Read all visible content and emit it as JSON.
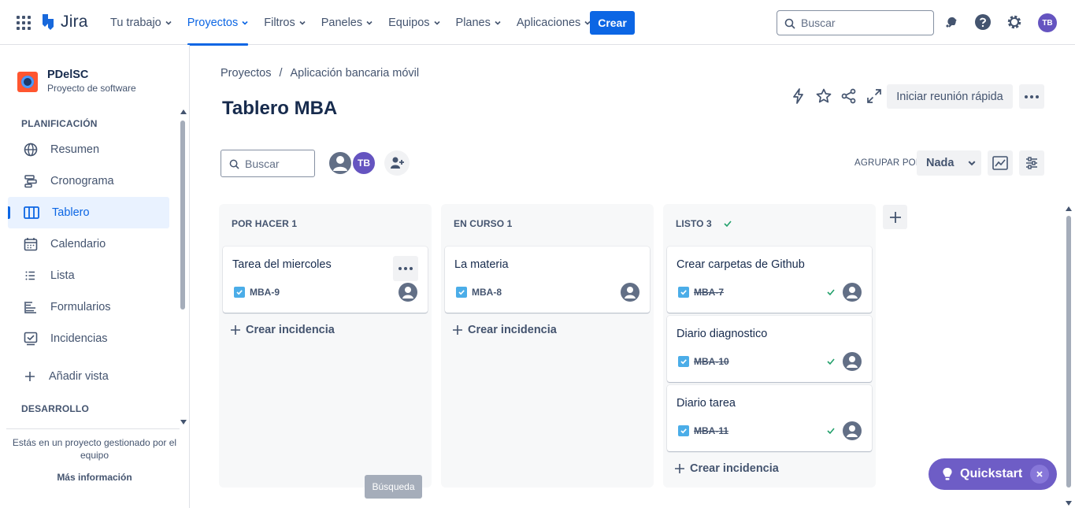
{
  "topnav": {
    "logo_text": "Jira",
    "items": [
      {
        "label": "Tu trabajo",
        "active": false
      },
      {
        "label": "Proyectos",
        "active": true
      },
      {
        "label": "Filtros",
        "active": false
      },
      {
        "label": "Paneles",
        "active": false
      },
      {
        "label": "Equipos",
        "active": false
      },
      {
        "label": "Planes",
        "active": false
      },
      {
        "label": "Aplicaciones",
        "active": false
      }
    ],
    "create_label": "Crear",
    "search_placeholder": "Buscar",
    "avatar_initials": "TB"
  },
  "sidebar": {
    "project_name": "PDelSC",
    "project_type": "Proyecto de software",
    "planning_title": "PLANIFICACIÓN",
    "items": [
      {
        "label": "Resumen",
        "icon": "globe-icon"
      },
      {
        "label": "Cronograma",
        "icon": "timeline-icon"
      },
      {
        "label": "Tablero",
        "icon": "board-icon",
        "active": true
      },
      {
        "label": "Calendario",
        "icon": "calendar-icon"
      },
      {
        "label": "Lista",
        "icon": "list-icon"
      },
      {
        "label": "Formularios",
        "icon": "forms-icon"
      },
      {
        "label": "Incidencias",
        "icon": "issues-icon"
      }
    ],
    "add_view_label": "Añadir vista",
    "development_title": "DESARROLLO",
    "footer_text": "Estás en un proyecto gestionado por el equipo",
    "footer_link": "Más información"
  },
  "main": {
    "breadcrumb": [
      "Proyectos",
      "/",
      "Aplicación bancaria móvil"
    ],
    "title": "Tablero MBA",
    "meet_label": "Iniciar reunión rápida",
    "search_placeholder": "Buscar",
    "user_initials": "TB",
    "group_label": "AGRUPAR POR",
    "group_value": "Nada"
  },
  "columns": [
    {
      "title": "POR HACER 1",
      "done": false,
      "cards": [
        {
          "title": "Tarea del miercoles",
          "key": "MBA-9",
          "done": false,
          "more": true
        }
      ]
    },
    {
      "title": "EN CURSO 1",
      "done": false,
      "cards": [
        {
          "title": "La materia",
          "key": "MBA-8",
          "done": false
        }
      ]
    },
    {
      "title": "LISTO 3",
      "done": true,
      "cards": [
        {
          "title": "Crear carpetas de Github",
          "key": "MBA-7",
          "done": true
        },
        {
          "title": "Diario diagnostico",
          "key": "MBA-10",
          "done": true
        },
        {
          "title": "Diario tarea",
          "key": "MBA-11",
          "done": true
        }
      ]
    }
  ],
  "create_issue_label": "Crear incidencia",
  "tooltip_text": "Búsqueda",
  "quickstart_label": "Quickstart",
  "colors": {
    "accent": "#0c66e4",
    "quickstart": "#6e5dc6",
    "done_check": "#22a06b"
  }
}
